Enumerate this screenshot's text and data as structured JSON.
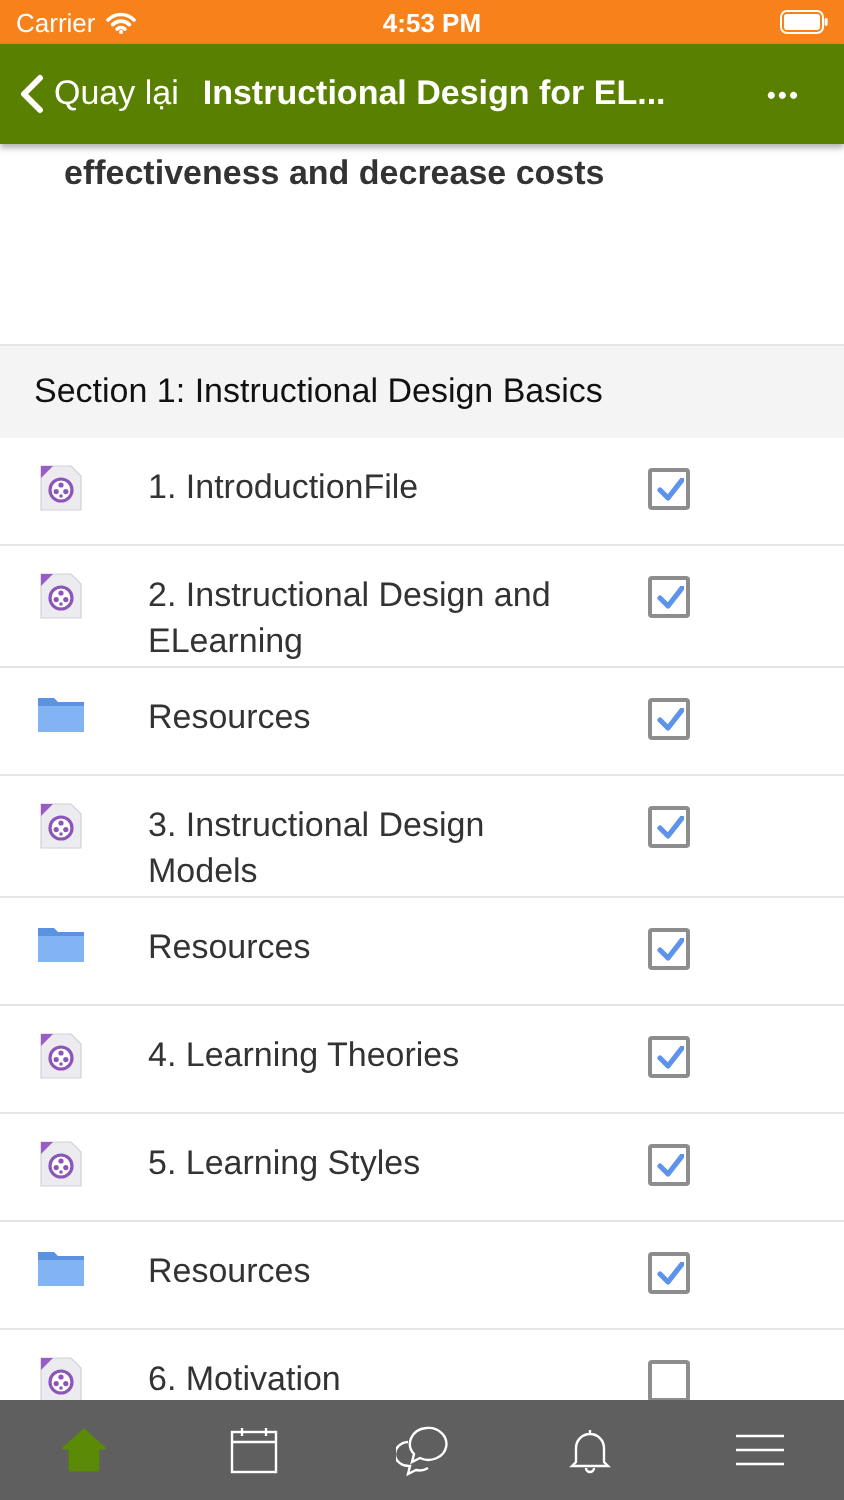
{
  "status_bar": {
    "carrier": "Carrier",
    "time": "4:53 PM"
  },
  "nav_bar": {
    "back_label": "Quay lại",
    "title": "Instructional Design for EL...",
    "more": "•••"
  },
  "intro_text": "effectiveness and decrease costs",
  "section": {
    "title": "Section 1: Instructional Design Basics"
  },
  "activities": [
    {
      "kind": "file",
      "title": "1. IntroductionFile",
      "checked": true
    },
    {
      "kind": "file",
      "title": "2. Instructional Design and ELearning",
      "checked": true
    },
    {
      "kind": "folder",
      "title": "Resources",
      "checked": true
    },
    {
      "kind": "file",
      "title": "3. Instructional Design Models",
      "checked": true
    },
    {
      "kind": "folder",
      "title": "Resources",
      "checked": true
    },
    {
      "kind": "file",
      "title": "4. Learning Theories",
      "checked": true
    },
    {
      "kind": "file",
      "title": "5. Learning Styles",
      "checked": true
    },
    {
      "kind": "folder",
      "title": "Resources",
      "checked": true
    },
    {
      "kind": "file",
      "title": "6. Motivation",
      "checked": false
    }
  ],
  "tab_bar": [
    {
      "kind": "home",
      "selected": true
    },
    {
      "kind": "calendar",
      "selected": false
    },
    {
      "kind": "messages",
      "selected": false
    },
    {
      "kind": "notifications",
      "selected": false
    },
    {
      "kind": "menu",
      "selected": false
    }
  ]
}
